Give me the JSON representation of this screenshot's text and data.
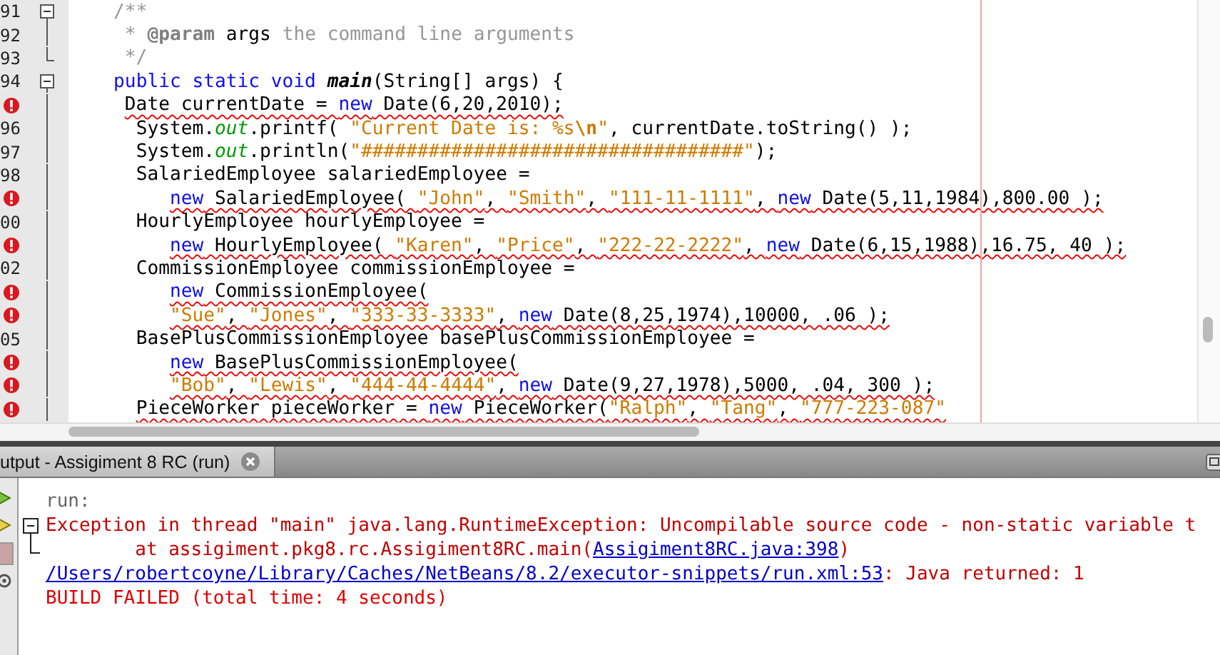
{
  "editor": {
    "lines": [
      {
        "number": "91",
        "error": false,
        "fold": {
          "kind": "start"
        },
        "segments": [
          {
            "text": "    /**",
            "kind": "comment"
          }
        ]
      },
      {
        "number": "92",
        "error": false,
        "fold": {
          "kind": "line"
        },
        "segments": [
          {
            "text": "     * ",
            "kind": "comment"
          },
          {
            "text": "@param",
            "kind": "tag"
          },
          {
            "text": " args",
            "kind": "plain"
          },
          {
            "text": " the command line arguments",
            "kind": "comment"
          }
        ]
      },
      {
        "number": "93",
        "error": false,
        "fold": {
          "kind": "end"
        },
        "segments": [
          {
            "text": "     */",
            "kind": "comment"
          }
        ]
      },
      {
        "number": "94",
        "error": false,
        "fold": {
          "kind": "start"
        },
        "segments": [
          {
            "text": "    public static void ",
            "kind": "kw"
          },
          {
            "text": "main",
            "kind": "method"
          },
          {
            "text": "(String[] args) {",
            "kind": "plain"
          }
        ]
      },
      {
        "error": true,
        "fold": {
          "kind": "line"
        },
        "segments": [
          {
            "text": "     Date currentDate = ",
            "kind": "plain"
          },
          {
            "text": "new",
            "kind": "kw"
          },
          {
            "text": " Date(6,20,2010);",
            "kind": "plain"
          }
        ]
      },
      {
        "number": "96",
        "error": false,
        "fold": {
          "kind": "line"
        },
        "segments": [
          {
            "text": "      System.",
            "kind": "plain"
          },
          {
            "text": "out",
            "kind": "field"
          },
          {
            "text": ".printf( ",
            "kind": "plain"
          },
          {
            "text": "\"Current Date is: %s",
            "kind": "str"
          },
          {
            "text": "\\n",
            "kind": "strbold"
          },
          {
            "text": "\"",
            "kind": "str"
          },
          {
            "text": ", currentDate.toString() );",
            "kind": "plain"
          }
        ]
      },
      {
        "number": "97",
        "error": false,
        "fold": {
          "kind": "line"
        },
        "segments": [
          {
            "text": "      System.",
            "kind": "plain"
          },
          {
            "text": "out",
            "kind": "field"
          },
          {
            "text": ".println(",
            "kind": "plain"
          },
          {
            "text": "\"##################################\"",
            "kind": "str"
          },
          {
            "text": ");",
            "kind": "plain"
          }
        ]
      },
      {
        "number": "98",
        "error": false,
        "fold": {
          "kind": "line"
        },
        "segments": [
          {
            "text": "      SalariedEmployee salariedEmployee =",
            "kind": "plain"
          }
        ]
      },
      {
        "error": true,
        "fold": {
          "kind": "line"
        },
        "segments": [
          {
            "text": "         new",
            "kind": "kw"
          },
          {
            "text": " SalariedEmployee( ",
            "kind": "plain"
          },
          {
            "text": "\"John\"",
            "kind": "str"
          },
          {
            "text": ", ",
            "kind": "plain"
          },
          {
            "text": "\"Smith\"",
            "kind": "str"
          },
          {
            "text": ", ",
            "kind": "plain"
          },
          {
            "text": "\"111-11-1111\"",
            "kind": "str"
          },
          {
            "text": ", ",
            "kind": "plain"
          },
          {
            "text": "new",
            "kind": "kw"
          },
          {
            "text": " Date(5,11,1984),800.00 );",
            "kind": "plain"
          }
        ]
      },
      {
        "number": "00",
        "error": false,
        "fold": {
          "kind": "line"
        },
        "segments": [
          {
            "text": "      HourlyEmployee hourlyEmployee =",
            "kind": "plain"
          }
        ]
      },
      {
        "error": true,
        "fold": {
          "kind": "line"
        },
        "segments": [
          {
            "text": "         new",
            "kind": "kw"
          },
          {
            "text": " HourlyEmployee( ",
            "kind": "plain"
          },
          {
            "text": "\"Karen\"",
            "kind": "str"
          },
          {
            "text": ", ",
            "kind": "plain"
          },
          {
            "text": "\"Price\"",
            "kind": "str"
          },
          {
            "text": ", ",
            "kind": "plain"
          },
          {
            "text": "\"222-22-2222\"",
            "kind": "str"
          },
          {
            "text": ", ",
            "kind": "plain"
          },
          {
            "text": "new",
            "kind": "kw"
          },
          {
            "text": " Date(6,15,1988),16.75, 40 );",
            "kind": "plain"
          }
        ]
      },
      {
        "number": "02",
        "error": false,
        "fold": {
          "kind": "line"
        },
        "segments": [
          {
            "text": "      CommissionEmployee commissionEmployee =",
            "kind": "plain"
          }
        ]
      },
      {
        "error": true,
        "fold": {
          "kind": "line"
        },
        "segments": [
          {
            "text": "         new",
            "kind": "kw"
          },
          {
            "text": " CommissionEmployee(",
            "kind": "plain"
          }
        ]
      },
      {
        "error": true,
        "fold": {
          "kind": "line"
        },
        "segments": [
          {
            "text": "         \"Sue\"",
            "kind": "str"
          },
          {
            "text": ", ",
            "kind": "plain"
          },
          {
            "text": "\"Jones\"",
            "kind": "str"
          },
          {
            "text": ", ",
            "kind": "plain"
          },
          {
            "text": "\"333-33-3333\"",
            "kind": "str"
          },
          {
            "text": ", ",
            "kind": "plain"
          },
          {
            "text": "new",
            "kind": "kw"
          },
          {
            "text": " Date(8,25,1974),10000, .06 );",
            "kind": "plain"
          }
        ]
      },
      {
        "number": "05",
        "error": false,
        "fold": {
          "kind": "line"
        },
        "segments": [
          {
            "text": "      BasePlusCommissionEmployee basePlusCommissionEmployee =",
            "kind": "plain"
          }
        ]
      },
      {
        "error": true,
        "fold": {
          "kind": "line"
        },
        "segments": [
          {
            "text": "         new",
            "kind": "kw"
          },
          {
            "text": " BasePlusCommissionEmployee(",
            "kind": "plain"
          }
        ]
      },
      {
        "error": true,
        "fold": {
          "kind": "line"
        },
        "segments": [
          {
            "text": "         \"Bob\"",
            "kind": "str"
          },
          {
            "text": ", ",
            "kind": "plain"
          },
          {
            "text": "\"Lewis\"",
            "kind": "str"
          },
          {
            "text": ", ",
            "kind": "plain"
          },
          {
            "text": "\"444-44-4444\"",
            "kind": "str"
          },
          {
            "text": ", ",
            "kind": "plain"
          },
          {
            "text": "new",
            "kind": "kw"
          },
          {
            "text": " Date(9,27,1978),5000, .04, 300 );",
            "kind": "plain"
          }
        ]
      },
      {
        "error": true,
        "fold": {
          "kind": "line"
        },
        "segments": [
          {
            "text": "      PieceWorker pieceWorker = ",
            "kind": "plain"
          },
          {
            "text": "new",
            "kind": "kw"
          },
          {
            "text": " PieceWorker(",
            "kind": "plain"
          },
          {
            "text": "\"Ralph\"",
            "kind": "str"
          },
          {
            "text": ", ",
            "kind": "plain"
          },
          {
            "text": "\"Tang\"",
            "kind": "str"
          },
          {
            "text": ", ",
            "kind": "plain"
          },
          {
            "text": "\"777-223-087\"",
            "kind": "str"
          }
        ]
      }
    ]
  },
  "output": {
    "tab": {
      "title": "utput - Assigiment 8 RC (run)",
      "selected": true
    },
    "lines": [
      {
        "segments": [
          {
            "text": "run:",
            "kind": "muted"
          }
        ]
      },
      {
        "fold": {
          "kind": "start"
        },
        "segments": [
          {
            "text": "Exception in thread \"main\" java.lang.RuntimeException: Uncompilable source code - non-static variable t",
            "kind": "error"
          }
        ]
      },
      {
        "fold": {
          "kind": "end"
        },
        "segments": [
          {
            "text": "        at assigiment.pkg8.rc.Assigiment8RC.main(",
            "kind": "error"
          },
          {
            "text": "Assigiment8RC.java:398",
            "kind": "link"
          },
          {
            "text": ")",
            "kind": "error"
          }
        ]
      },
      {
        "segments": [
          {
            "text": "/Users/robertcoyne/Library/Caches/NetBeans/8.2/executor-snippets/run.xml:53",
            "kind": "link"
          },
          {
            "text": ": Java returned: 1",
            "kind": "error"
          }
        ]
      },
      {
        "segments": [
          {
            "text": "BUILD FAILED (total time: 4 seconds)",
            "kind": "failed"
          }
        ]
      }
    ]
  }
}
